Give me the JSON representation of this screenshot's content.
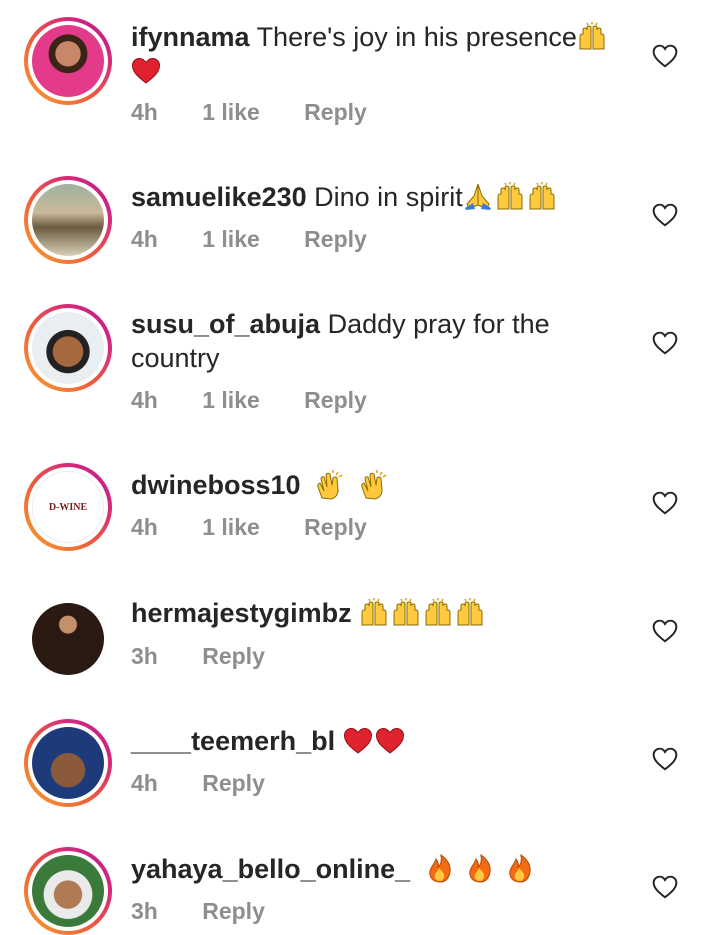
{
  "comments": [
    {
      "username": "ifynnama",
      "text": "There's joy in his presence",
      "emoji": "🙌❤️",
      "time": "4h",
      "likes": "1 like",
      "reply": "Reply"
    },
    {
      "username": "samuelike230",
      "text": "Dino in spirit",
      "emoji": "🙏🙌🙌",
      "time": "4h",
      "likes": "1 like",
      "reply": "Reply"
    },
    {
      "username": "susu_of_abuja",
      "text": "Daddy pray for the",
      "text2": "country",
      "time": "4h",
      "likes": "1 like",
      "reply": "Reply"
    },
    {
      "username": "dwineboss10",
      "text": "",
      "emoji": "👏👏",
      "time": "4h",
      "likes": "1 like",
      "reply": "Reply",
      "avatar_text": "D-WINE"
    },
    {
      "username": "hermajestygimbz",
      "text": "",
      "emoji": "🙌🙌🙌🙌",
      "time": "3h",
      "reply": "Reply"
    },
    {
      "username": "____teemerh_bl",
      "text": "",
      "emoji": "❤️❤️",
      "time": "4h",
      "reply": "Reply"
    },
    {
      "username": "yahaya_bello_online_",
      "text": "",
      "emoji": "🔥🔥🔥",
      "time": "3h",
      "reply": "Reply"
    }
  ],
  "colors": {
    "meta": "#8e8e8e",
    "ring_start": "#f9a12e",
    "ring_end": "#b81e8e",
    "text": "#262626"
  }
}
